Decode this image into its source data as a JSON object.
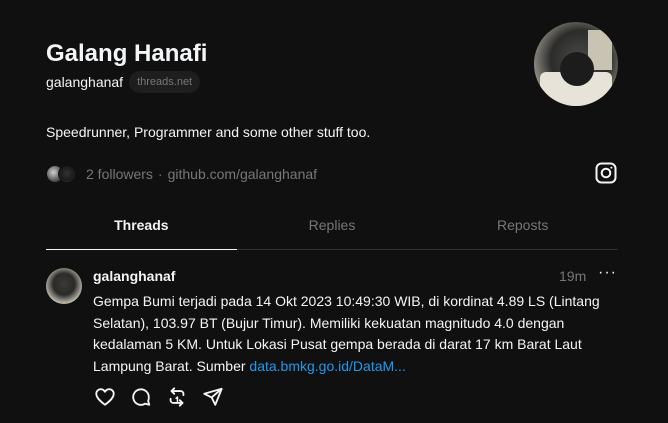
{
  "profile": {
    "name": "Galang Hanafi",
    "handle": "galanghanaf",
    "domain_pill": "threads.net",
    "bio": "Speedrunner, Programmer and some other stuff too.",
    "followers": "2 followers",
    "separator": "·",
    "link": "github.com/galanghanaf",
    "instagram_icon": "instagram-icon"
  },
  "tabs": [
    {
      "label": "Threads",
      "active": true
    },
    {
      "label": "Replies",
      "active": false
    },
    {
      "label": "Reposts",
      "active": false
    }
  ],
  "post": {
    "username": "galanghanaf",
    "time": "19m",
    "more": "···",
    "text": "Gempa Bumi terjadi pada 14 Okt 2023 10:49:30 WIB, di kordinat 4.89 LS (Lintang Selatan), 103.97 BT (Bujur Timur). Memiliki kekuatan magnitudo 4.0 dengan kedalaman 5 KM. Untuk Lokasi Pusat gempa berada di darat 17 km Barat Laut Lampung Barat. Sumber ",
    "link_text": "data.bmkg.go.id/DataM...",
    "actions": [
      "heart-icon",
      "comment-icon",
      "repost-icon",
      "share-icon"
    ]
  },
  "colors": {
    "background": "#101010",
    "text": "#f3f5f7",
    "muted": "#777777",
    "link": "#1d9bf0",
    "divider": "#323232"
  }
}
